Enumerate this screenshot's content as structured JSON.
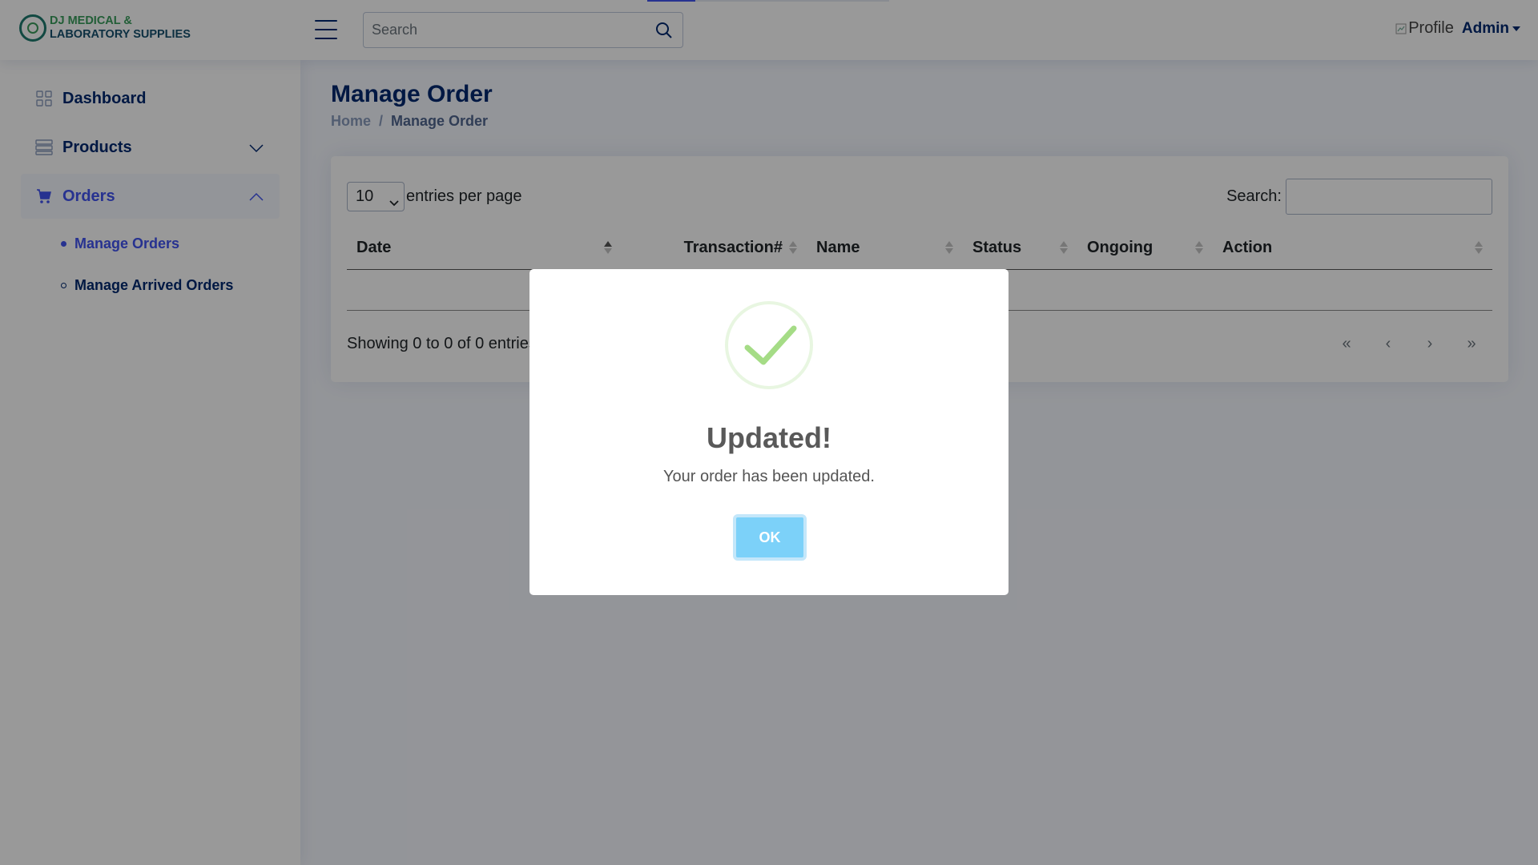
{
  "header": {
    "logo_line1": "DJ MEDICAL &",
    "logo_line2": "LABORATORY SUPPLIES",
    "search_placeholder": "Search",
    "profile_alt": "Profile",
    "user_name": "Admin",
    "page_load_progress": 0.2
  },
  "sidebar": {
    "items": [
      {
        "label": "Dashboard",
        "icon": "grid-icon"
      },
      {
        "label": "Products",
        "icon": "layers-icon"
      },
      {
        "label": "Orders",
        "icon": "cart-icon",
        "expanded": true
      }
    ],
    "sub_items": [
      {
        "label": "Manage Orders",
        "active": true
      },
      {
        "label": "Manage Arrived Orders",
        "active": false
      }
    ]
  },
  "main": {
    "title": "Manage Order",
    "breadcrumb": [
      "Home",
      "Manage Order"
    ],
    "table": {
      "entries_value": "10",
      "entries_label": "entries per page",
      "search_label": "Search:",
      "columns": [
        "Date",
        "Transaction#",
        "Name",
        "Status",
        "Ongoing",
        "Action"
      ],
      "rows": [],
      "info": "Showing 0 to 0 of 0 entries",
      "pager": [
        "«",
        "‹",
        "›",
        "»"
      ]
    }
  },
  "modal": {
    "icon": "success-check-icon",
    "title": "Updated!",
    "text": "Your order has been updated.",
    "button": "OK"
  },
  "colors": {
    "primary": "#4154f1",
    "navy": "#012970",
    "success": "#a5dc86",
    "ok_button": "#7cd1f9"
  }
}
